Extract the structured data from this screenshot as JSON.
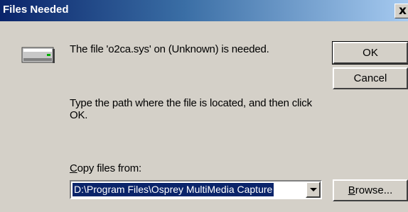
{
  "window": {
    "title": "Files Needed",
    "close_glyph": "x"
  },
  "icon": {
    "name": "drive-icon"
  },
  "messages": {
    "needed": "The file 'o2ca.sys' on (Unknown) is needed.",
    "instruction": "Type the path where the file is located, and then click OK."
  },
  "copy_from": {
    "label_accel": "C",
    "label_rest": "opy files from:",
    "value": "D:\\Program Files\\Osprey MultiMedia Capture"
  },
  "buttons": {
    "ok": "OK",
    "cancel": "Cancel",
    "browse_accel": "B",
    "browse_rest": "rowse..."
  }
}
